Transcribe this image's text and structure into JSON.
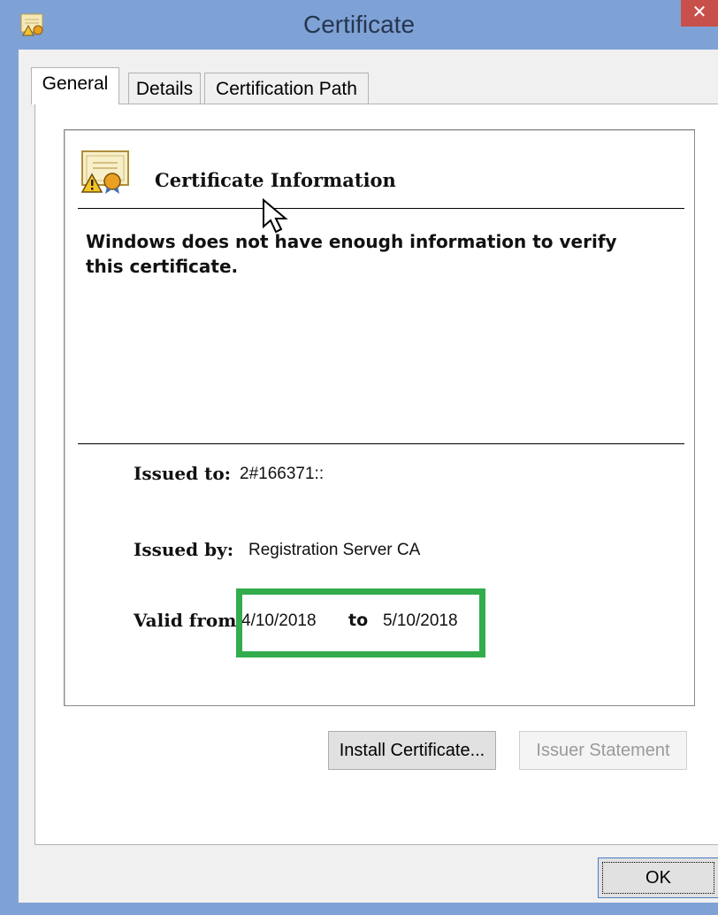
{
  "window": {
    "title": "Certificate",
    "close_glyph": "✕"
  },
  "tabs": [
    {
      "label": "General",
      "active": true
    },
    {
      "label": "Details",
      "active": false
    },
    {
      "label": "Certification Path",
      "active": false
    }
  ],
  "info": {
    "heading": "Certificate Information",
    "warning": "Windows does not have enough information to verify this certificate.",
    "issued_to_label": "Issued to:",
    "issued_to_value": "2#166371::",
    "issued_by_label": "Issued by:",
    "issued_by_value": "Registration Server CA",
    "valid_from_label": "Valid from",
    "valid_from_value": "4/10/2018",
    "valid_to_word": "to",
    "valid_to_value": "5/10/2018"
  },
  "buttons": {
    "install_certificate": "Install Certificate...",
    "issuer_statement": "Issuer Statement",
    "ok": "OK"
  },
  "colors": {
    "highlight": "#32ac4c",
    "titlebar": "#7fa2d6",
    "close": "#c7504a"
  },
  "icons": {
    "window": "certificate-warning-icon",
    "info": "certificate-warning-icon",
    "cursor": "mouse-pointer-icon"
  }
}
